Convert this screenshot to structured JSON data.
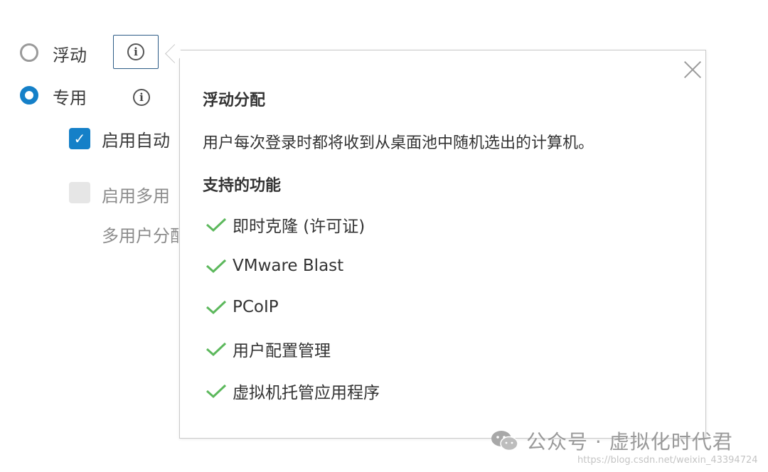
{
  "options": {
    "floating_label": "浮动",
    "dedicated_label": "专用"
  },
  "checkboxes": {
    "auto_label": "启用自动",
    "multi_label": "启用多用",
    "multi_note": "多用户分配"
  },
  "popover": {
    "title": "浮动分配",
    "description": "用户每次登录时都将收到从桌面池中随机选出的计算机。",
    "features_title": "支持的功能",
    "features": [
      "即时克隆 (许可证)",
      "VMware Blast",
      "PCoIP",
      "用户配置管理",
      "虚拟机托管应用程序"
    ]
  },
  "watermark": {
    "text": "公众号 · 虚拟化时代君",
    "url": "https://blog.csdn.net/weixin_43394724"
  },
  "colors": {
    "accent": "#1580c8",
    "check": "#5cb85c"
  }
}
